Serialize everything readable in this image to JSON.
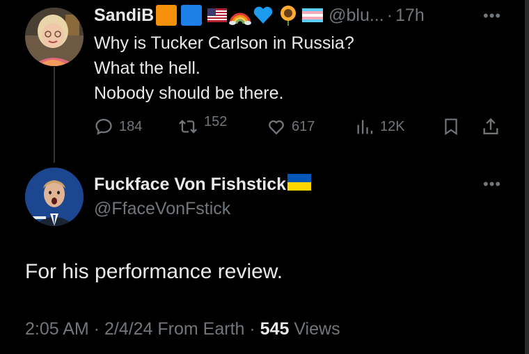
{
  "parent_tweet": {
    "display_name": "SandiB",
    "handle": "@blu...",
    "separator": "·",
    "time": "17h",
    "more_label": "•••",
    "lines": [
      "Why is Tucker Carlson in Russia?",
      "What the hell.",
      "Nobody should be there."
    ],
    "actions": {
      "replies": "184",
      "reposts": "152",
      "likes": "617",
      "views": "12K"
    }
  },
  "reply_tweet": {
    "display_name": "Fuckface Von Fishstick",
    "handle": "@FfaceVonFstick",
    "more_label": "•••",
    "text": "For his performance review.",
    "meta": {
      "time": "2:05 AM",
      "sep1": " · ",
      "date": "2/4/24",
      "source": " From Earth",
      "sep2": " · ",
      "views_count": "545",
      "views_label": " Views"
    }
  },
  "colors": {
    "background": "#000000",
    "text": "#e7e9ea",
    "muted": "#71767b",
    "divider": "#333639",
    "orange_square": "#f4900c",
    "blue_square": "#1d80e8",
    "blue_heart": "#1d9bf0",
    "ukraine_blue": "#0057b7",
    "ukraine_yellow": "#ffd700"
  },
  "icons": [
    "us-flag-emoji",
    "rainbow-emoji",
    "sunflower-emoji",
    "transgender-flag-emoji",
    "ukraine-flag-emoji",
    "reply-icon",
    "repost-icon",
    "like-icon",
    "views-icon",
    "bookmark-icon",
    "share-icon"
  ]
}
